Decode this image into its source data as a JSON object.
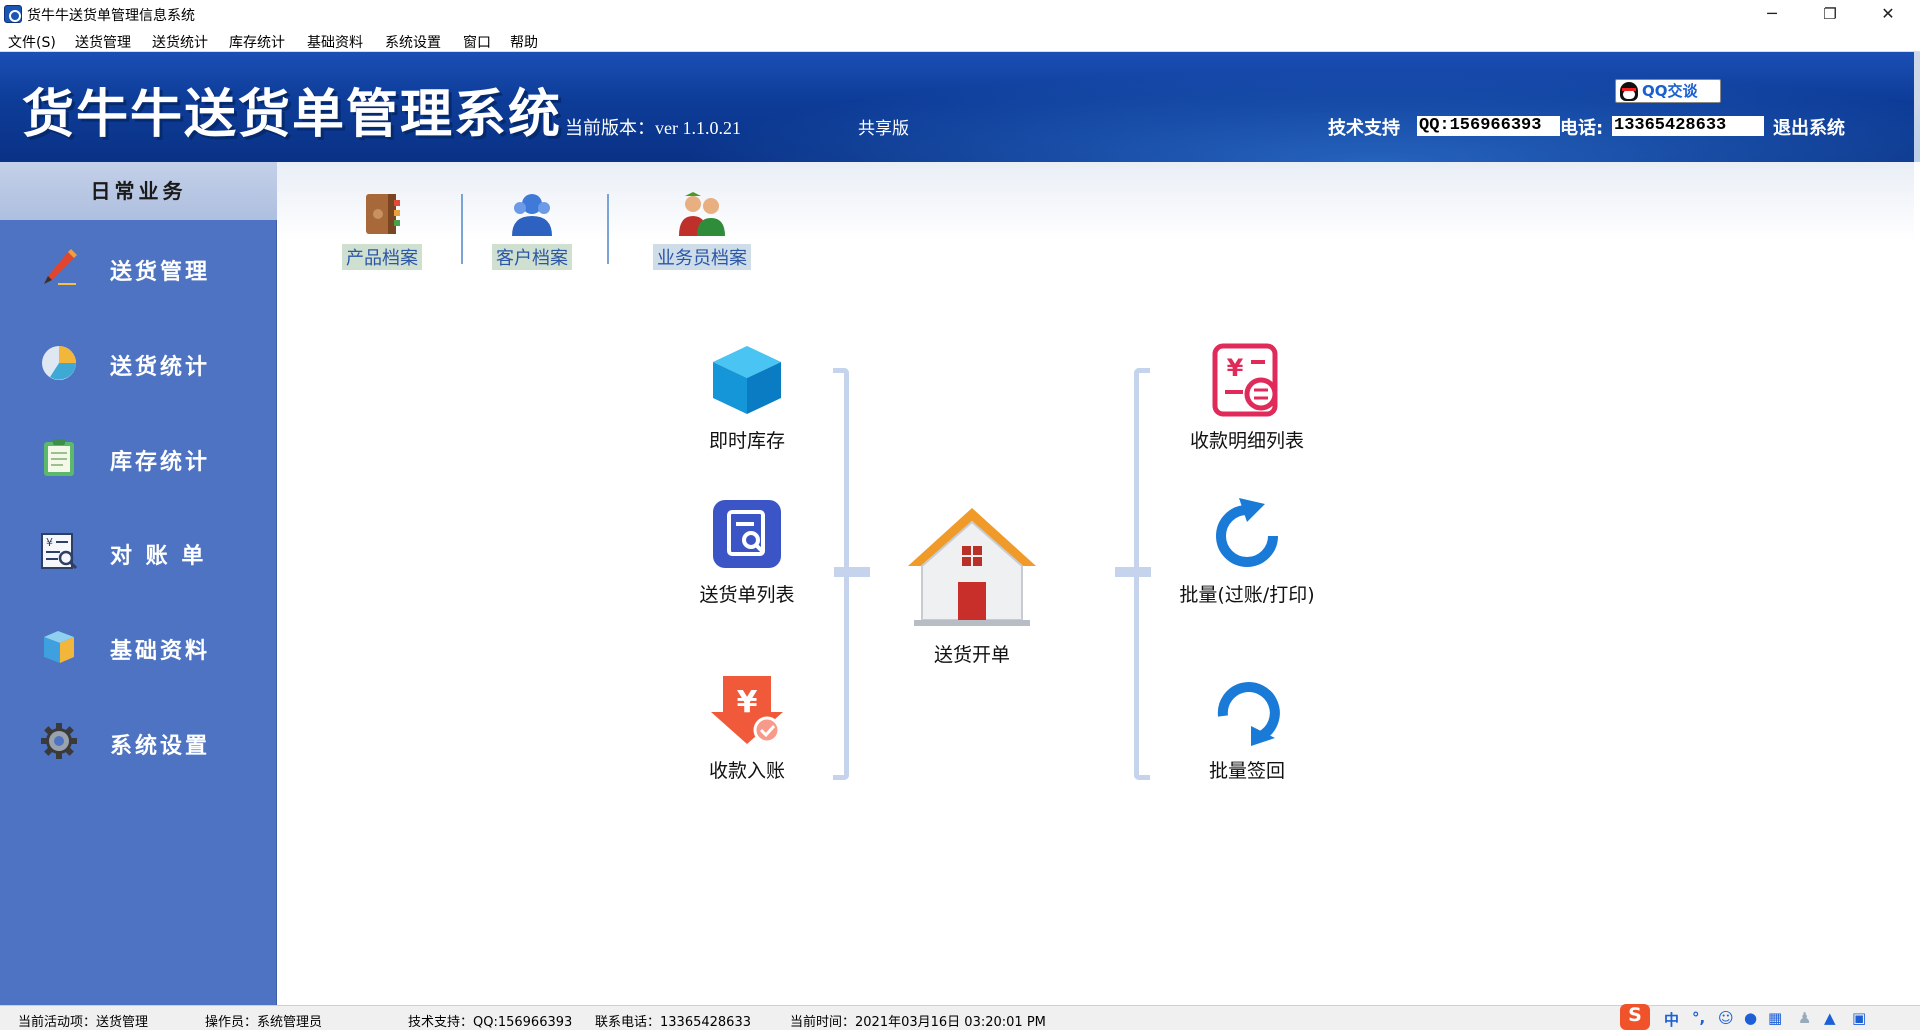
{
  "window": {
    "title": "货牛牛送货单管理信息系统",
    "minimize": "─",
    "restore": "❐",
    "close": "✕"
  },
  "menu": [
    "文件(S)",
    "送货管理",
    "送货统计",
    "库存统计",
    "基础资料",
    "系统设置",
    "窗口",
    "帮助"
  ],
  "banner": {
    "title": "货牛牛送货单管理系统",
    "version": "当前版本：ver 1.1.0.21",
    "edition": "共享版",
    "qq_button": "QQ交谈",
    "support_label": "技术支持",
    "qq_value": "QQ:156966393",
    "tel_label": "电话:",
    "tel_value": "13365428633",
    "exit": "退出系统"
  },
  "sidebar": {
    "header": "日常业务",
    "items": [
      {
        "label": "送货管理",
        "icon": "pencil-icon"
      },
      {
        "label": "送货统计",
        "icon": "pie-chart-icon"
      },
      {
        "label": "库存统计",
        "icon": "clipboard-icon"
      },
      {
        "label": "对 账 单",
        "icon": "statement-icon"
      },
      {
        "label": "基础资料",
        "icon": "box-icon"
      },
      {
        "label": "系统设置",
        "icon": "gear-icon"
      }
    ]
  },
  "toolbar": [
    {
      "label": "产品档案",
      "icon": "book-icon"
    },
    {
      "label": "客户档案",
      "icon": "customer-icon"
    },
    {
      "label": "业务员档案",
      "icon": "salesman-icon"
    }
  ],
  "hub": {
    "center": "送货开单",
    "left": [
      "即时库存",
      "送货单列表",
      "收款入账"
    ],
    "right": [
      "收款明细列表",
      "批量(过账/打印)",
      "批量签回"
    ]
  },
  "status": {
    "activity": "当前活动项：送货管理",
    "operator": "操作员：系统管理员",
    "support": "技术支持：QQ:156966393",
    "phone": "联系电话：13365428633",
    "time": "当前时间：2021年03月16日 03:20:01 PM"
  },
  "ime": {
    "logo": "S",
    "mode": "中",
    "punct": "°,"
  },
  "colors": {
    "banner": "#0d3c98",
    "sidebar": "#4d73c2",
    "bracket": "#c6d3ec",
    "link": "#2b56a8"
  }
}
